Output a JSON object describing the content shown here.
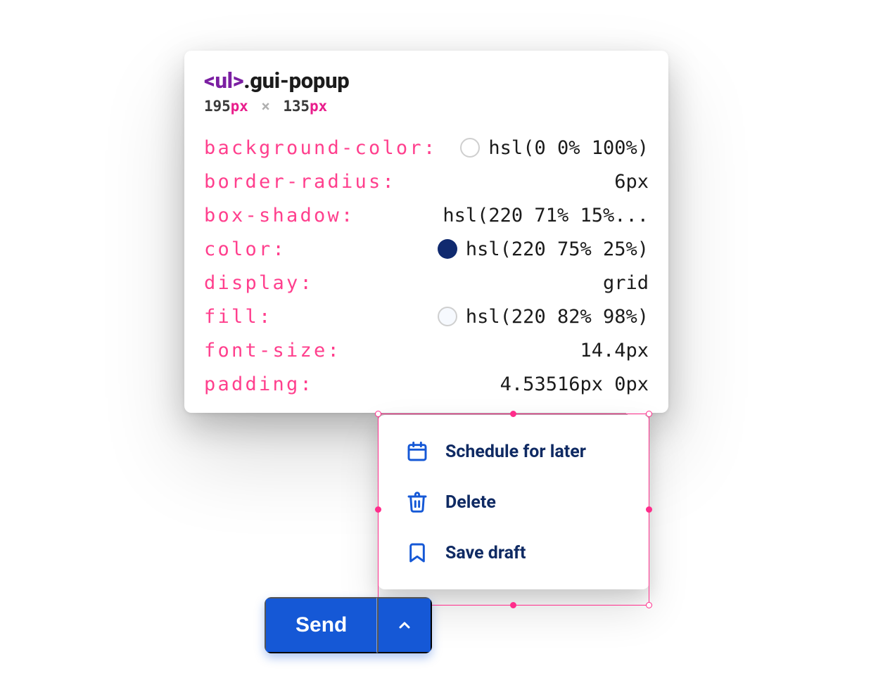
{
  "tooltip": {
    "title_tag": "<ul>",
    "title_class": ".gui-popup",
    "dims": {
      "w_num": "195",
      "w_unit": "px",
      "sep": "×",
      "h_num": "135",
      "h_unit": "px"
    },
    "properties": [
      {
        "name": "background-color",
        "value": "hsl(0 0% 100%)",
        "swatch": "#ffffff",
        "swatch_border": true
      },
      {
        "name": "border-radius",
        "value": "6px"
      },
      {
        "name": "box-shadow",
        "value": "hsl(220 71% 15%..."
      },
      {
        "name": "color",
        "value": "hsl(220 75% 25%)",
        "swatch": "#102a6f",
        "swatch_border": false
      },
      {
        "name": "display",
        "value": "grid"
      },
      {
        "name": "fill",
        "value": "hsl(220 82% 98%)",
        "swatch": "#f6f9fe",
        "swatch_border": true
      },
      {
        "name": "font-size",
        "value": "14.4px"
      },
      {
        "name": "padding",
        "value": "4.53516px 0px"
      }
    ]
  },
  "popup": {
    "items": [
      {
        "icon": "calendar-icon",
        "label": "Schedule for later"
      },
      {
        "icon": "trash-icon",
        "label": "Delete"
      },
      {
        "icon": "bookmark-icon",
        "label": "Save draft"
      }
    ]
  },
  "send_button": {
    "label": "Send"
  }
}
